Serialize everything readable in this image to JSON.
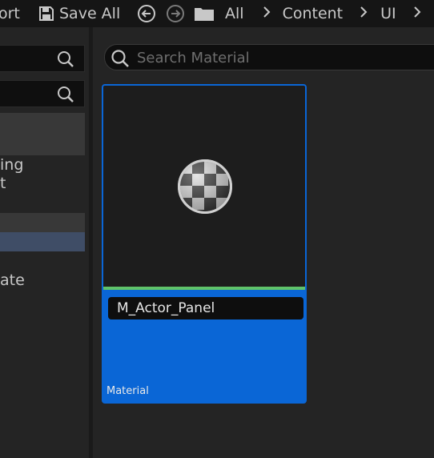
{
  "toolbar": {
    "import_label": "ort",
    "save_all_label": "Save All",
    "breadcrumbs": [
      "All",
      "Content",
      "UI"
    ]
  },
  "left_panel": {
    "item_a_line1": "ing",
    "item_a_line2": "t",
    "item_b": "ate"
  },
  "search": {
    "placeholder": "Search Material"
  },
  "asset": {
    "name": "M_Actor_Panel",
    "type": "Material"
  },
  "colors": {
    "selection": "#0a66d6",
    "material_strip": "#5fc36a",
    "left_selected": "#3f4d66"
  }
}
